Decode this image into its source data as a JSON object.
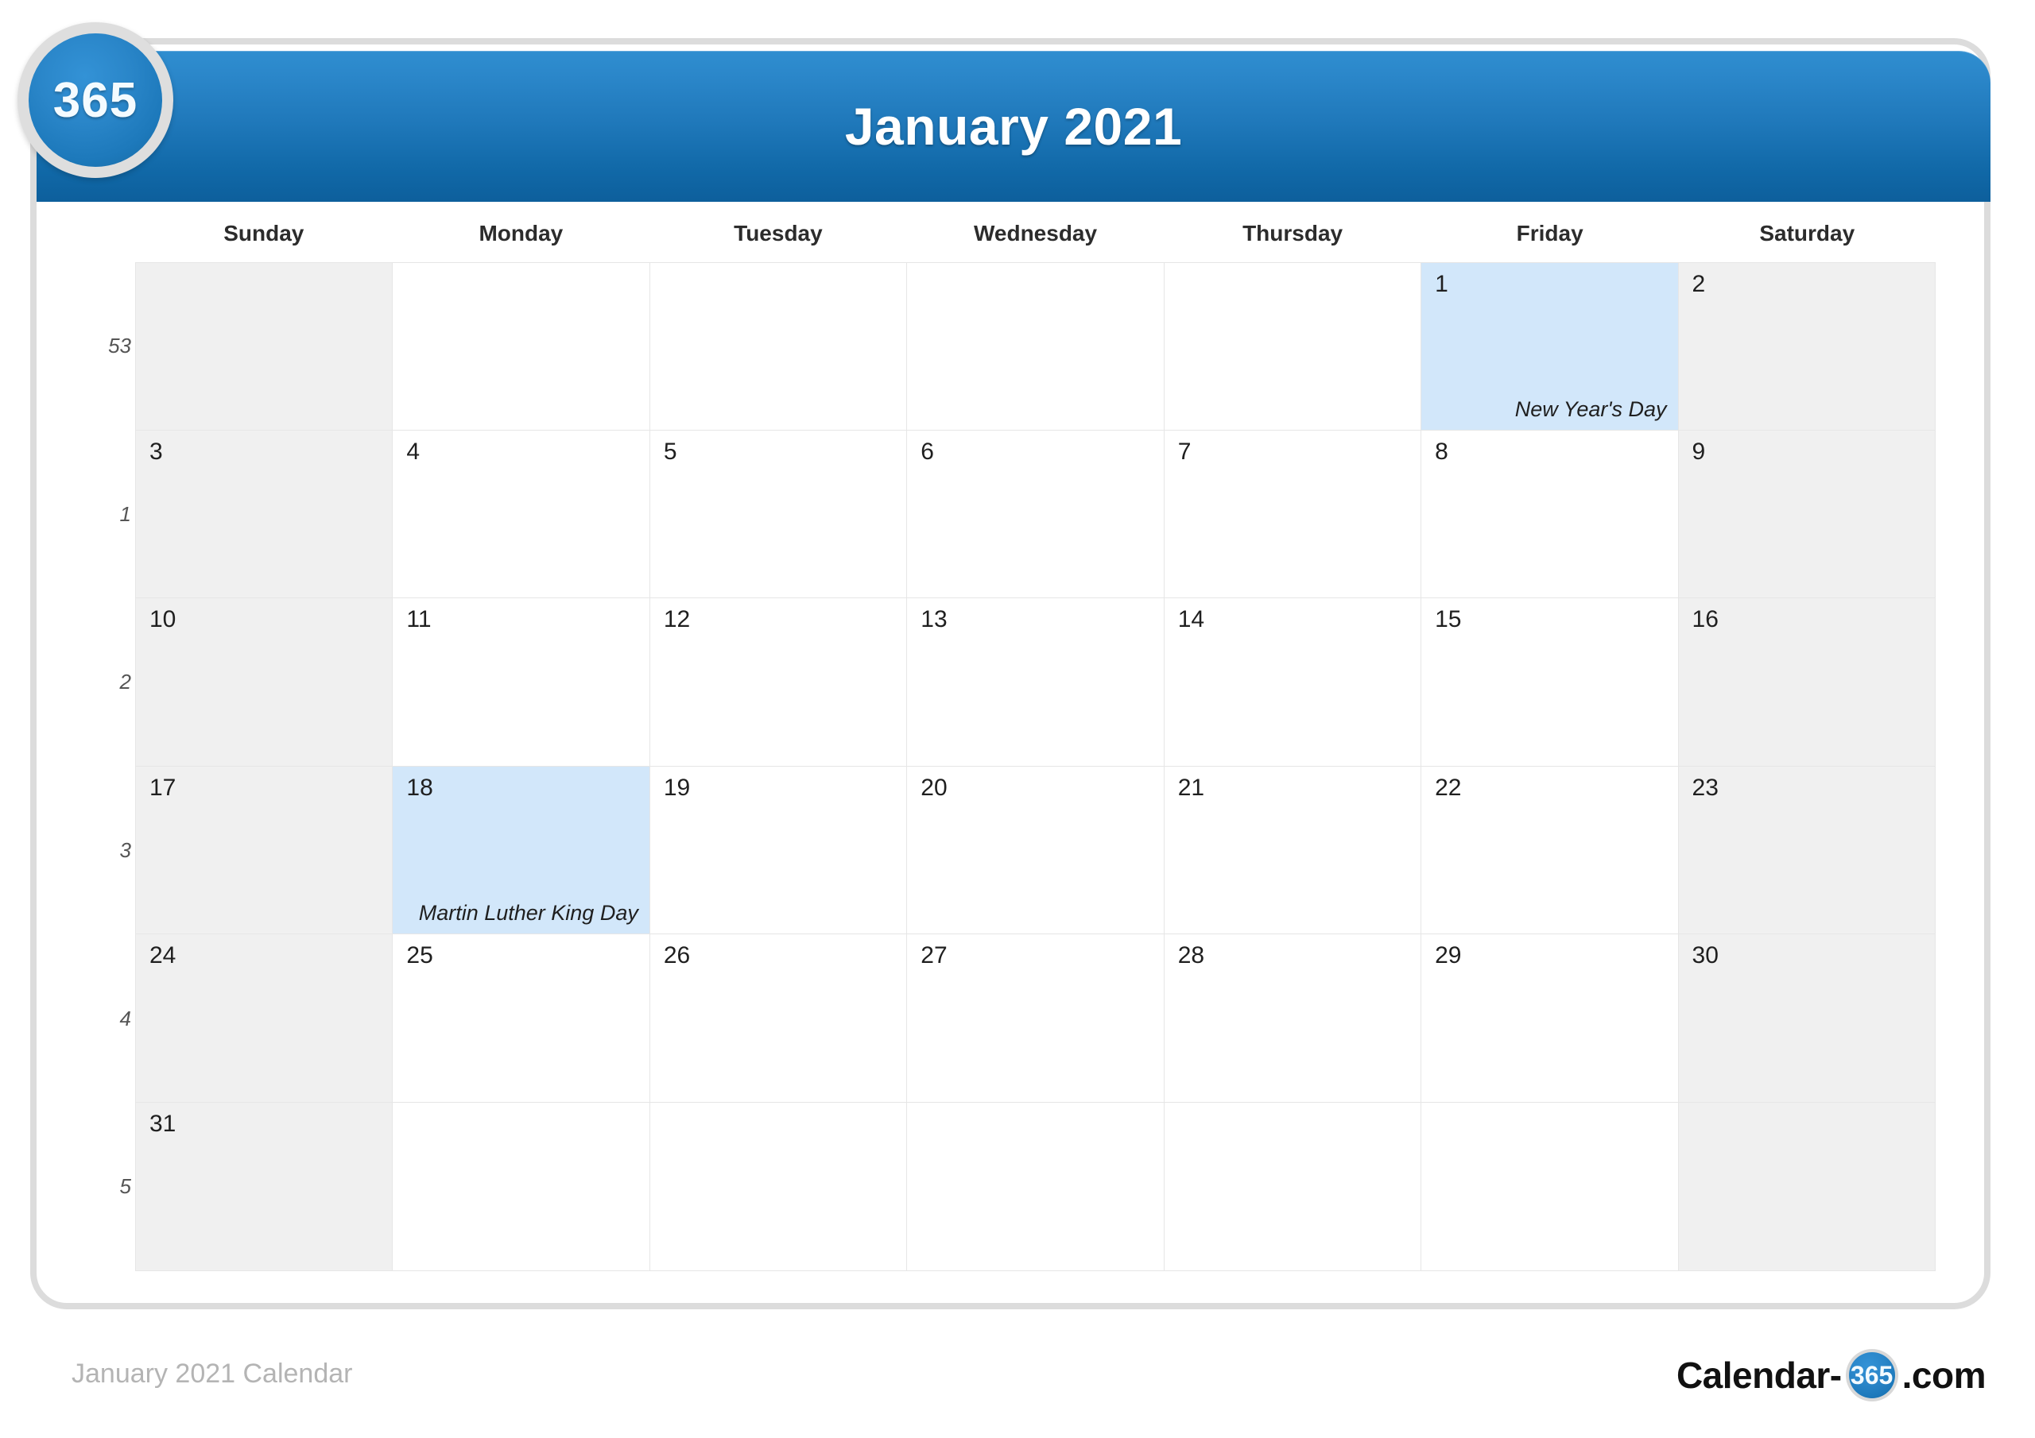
{
  "brand": {
    "badge_text": "365",
    "footer_logo_prefix": "Calendar-",
    "footer_logo_badge": "365",
    "footer_logo_suffix": ".com",
    "watermark_text": "365",
    "accent_color": "#1f78ba",
    "holiday_color": "#d2e7fa",
    "weekend_color": "#f0f0f0"
  },
  "header": {
    "title": "January 2021"
  },
  "weekdays": [
    "Sunday",
    "Monday",
    "Tuesday",
    "Wednesday",
    "Thursday",
    "Friday",
    "Saturday"
  ],
  "calendar": {
    "month": "January",
    "year": "2021",
    "week_numbers": [
      "53",
      "1",
      "2",
      "3",
      "4",
      "5"
    ],
    "weeks": [
      [
        {
          "day": "",
          "weekend": true,
          "holiday": false,
          "label": ""
        },
        {
          "day": "",
          "weekend": false,
          "holiday": false,
          "label": ""
        },
        {
          "day": "",
          "weekend": false,
          "holiday": false,
          "label": ""
        },
        {
          "day": "",
          "weekend": false,
          "holiday": false,
          "label": ""
        },
        {
          "day": "",
          "weekend": false,
          "holiday": false,
          "label": ""
        },
        {
          "day": "1",
          "weekend": false,
          "holiday": true,
          "label": "New Year's Day"
        },
        {
          "day": "2",
          "weekend": true,
          "holiday": false,
          "label": ""
        }
      ],
      [
        {
          "day": "3",
          "weekend": true,
          "holiday": false,
          "label": ""
        },
        {
          "day": "4",
          "weekend": false,
          "holiday": false,
          "label": ""
        },
        {
          "day": "5",
          "weekend": false,
          "holiday": false,
          "label": ""
        },
        {
          "day": "6",
          "weekend": false,
          "holiday": false,
          "label": ""
        },
        {
          "day": "7",
          "weekend": false,
          "holiday": false,
          "label": ""
        },
        {
          "day": "8",
          "weekend": false,
          "holiday": false,
          "label": ""
        },
        {
          "day": "9",
          "weekend": true,
          "holiday": false,
          "label": ""
        }
      ],
      [
        {
          "day": "10",
          "weekend": true,
          "holiday": false,
          "label": ""
        },
        {
          "day": "11",
          "weekend": false,
          "holiday": false,
          "label": ""
        },
        {
          "day": "12",
          "weekend": false,
          "holiday": false,
          "label": ""
        },
        {
          "day": "13",
          "weekend": false,
          "holiday": false,
          "label": ""
        },
        {
          "day": "14",
          "weekend": false,
          "holiday": false,
          "label": ""
        },
        {
          "day": "15",
          "weekend": false,
          "holiday": false,
          "label": ""
        },
        {
          "day": "16",
          "weekend": true,
          "holiday": false,
          "label": ""
        }
      ],
      [
        {
          "day": "17",
          "weekend": true,
          "holiday": false,
          "label": ""
        },
        {
          "day": "18",
          "weekend": false,
          "holiday": true,
          "label": "Martin Luther King Day"
        },
        {
          "day": "19",
          "weekend": false,
          "holiday": false,
          "label": ""
        },
        {
          "day": "20",
          "weekend": false,
          "holiday": false,
          "label": ""
        },
        {
          "day": "21",
          "weekend": false,
          "holiday": false,
          "label": ""
        },
        {
          "day": "22",
          "weekend": false,
          "holiday": false,
          "label": ""
        },
        {
          "day": "23",
          "weekend": true,
          "holiday": false,
          "label": ""
        }
      ],
      [
        {
          "day": "24",
          "weekend": true,
          "holiday": false,
          "label": ""
        },
        {
          "day": "25",
          "weekend": false,
          "holiday": false,
          "label": ""
        },
        {
          "day": "26",
          "weekend": false,
          "holiday": false,
          "label": ""
        },
        {
          "day": "27",
          "weekend": false,
          "holiday": false,
          "label": ""
        },
        {
          "day": "28",
          "weekend": false,
          "holiday": false,
          "label": ""
        },
        {
          "day": "29",
          "weekend": false,
          "holiday": false,
          "label": ""
        },
        {
          "day": "30",
          "weekend": true,
          "holiday": false,
          "label": ""
        }
      ],
      [
        {
          "day": "31",
          "weekend": true,
          "holiday": false,
          "label": ""
        },
        {
          "day": "",
          "weekend": false,
          "holiday": false,
          "label": ""
        },
        {
          "day": "",
          "weekend": false,
          "holiday": false,
          "label": ""
        },
        {
          "day": "",
          "weekend": false,
          "holiday": false,
          "label": ""
        },
        {
          "day": "",
          "weekend": false,
          "holiday": false,
          "label": ""
        },
        {
          "day": "",
          "weekend": false,
          "holiday": false,
          "label": ""
        },
        {
          "day": "",
          "weekend": true,
          "holiday": false,
          "label": ""
        }
      ]
    ]
  },
  "footer": {
    "caption": "January 2021 Calendar"
  }
}
